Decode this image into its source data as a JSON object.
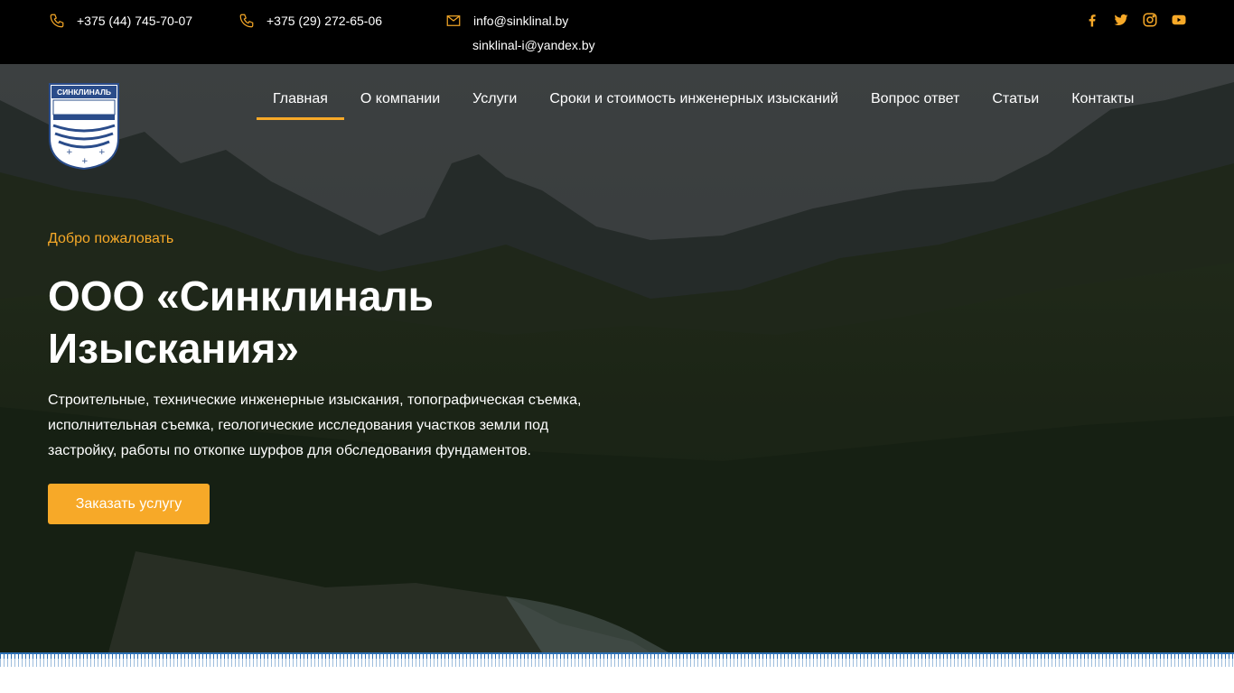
{
  "topbar": {
    "phone1": "+375 (44) 745-70-07",
    "phone2": "+375 (29) 272-65-06",
    "email1": "info@sinklinal.by",
    "email2": "sinklinal-i@yandex.by",
    "phone_icon": "phone-icon",
    "mail_icon": "mail-icon",
    "socials": [
      "facebook-icon",
      "twitter-icon",
      "instagram-icon",
      "youtube-icon"
    ]
  },
  "logo": {
    "text": "СИНКЛИНАЛЬ"
  },
  "nav": {
    "items": [
      {
        "label": "Главная",
        "active": true
      },
      {
        "label": "О компании"
      },
      {
        "label": "Услуги"
      },
      {
        "label": "Сроки и стоимость инженерных изысканий"
      },
      {
        "label": "Вопрос ответ"
      },
      {
        "label": "Статьи"
      },
      {
        "label": "Контакты"
      }
    ]
  },
  "hero": {
    "welcome": "Добро пожаловать",
    "title": "ООО «Синклиналь Изыскания»",
    "description": "Строительные, технические инженерные изыскания, топографическая съемка, исполнительная съемка, геологические исследования участков земли под застройку, работы по откопке шурфов для обследования фундаментов.",
    "cta": "Заказать услугу"
  },
  "colors": {
    "accent": "#f7a928",
    "topbar": "#000000",
    "ruler": "#2c6fb3"
  }
}
